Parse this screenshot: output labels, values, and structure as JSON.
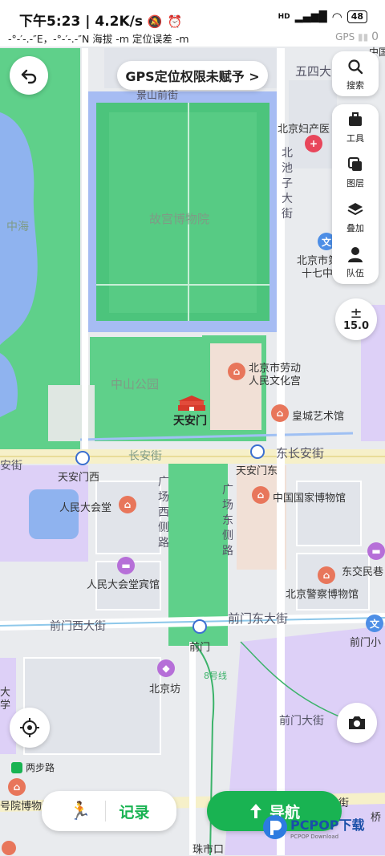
{
  "status": {
    "time": "下午5:23",
    "speed": "4.2K/s",
    "battery": "48",
    "hd": "HD"
  },
  "coords": {
    "text": "-°-′-.-″E，-°-′-.-″N  海拔 -m    定位误差 -m",
    "gps_label": "GPS",
    "gps_signal": "0"
  },
  "gps_banner": {
    "label": "GPS定位权限未赋予 >"
  },
  "toolbar": {
    "search": "搜索",
    "tools": "工具",
    "layers": "图层",
    "overlay": "叠加",
    "team": "队伍",
    "zoom": "15.0"
  },
  "map_labels": {
    "palace": "故宫博物院",
    "zhonghai": "中海",
    "zhongshan": "中山公园",
    "tiananmen": "天安门",
    "changanjie": "长安街",
    "dongchangan": "东长安街",
    "tiananmen_west": "天安门西",
    "tiananmen_east": "天安门东",
    "renmin_dahuitang": "人民大会堂",
    "guoja_bowuguan": "中国国家博物馆",
    "dahuitang_binguan": "人民大会堂宾馆",
    "qianmen_xidajie": "前门西大街",
    "qianmen_dongdajie": "前门东大街",
    "qianmen": "前门",
    "beijingfang": "北京坊",
    "qianmen_dajie": "前门大街",
    "laodong_wenhuagong_1": "北京市劳动",
    "laodong_wenhuagong_2": "人民文化宫",
    "huangcheng": "皇城艺术馆",
    "fuchanyuan": "北京妇产医",
    "shiqizhong_1": "北京市第",
    "shiqizhong_2": "十七中",
    "police_museum": "北京警察博物馆",
    "dongjiaomin": "东交民巷",
    "qianmenxiao": "前门小",
    "wusi": "五四大",
    "jingshan": "景山前街",
    "liangbu": "两步路",
    "line8": "8号线",
    "zhushikou": "珠市口",
    "bowuguan_left": "号院博物馆",
    "daxue_1": "大",
    "daxue_2": "学",
    "an_left": "安街",
    "zhongguo_top": "中国",
    "guangchang_west": "广场西侧路",
    "guangchang_east": "广场东侧路",
    "beichizi": "北池子大街",
    "qiao": "桥",
    "jie": "街"
  },
  "bottom": {
    "record": "记录",
    "navigate": "导航"
  },
  "watermark": {
    "brand": "PCPOP下载",
    "sub": "PCPOP Download"
  },
  "colors": {
    "park_green": "#5fd08a",
    "palace_green": "#4cc47c",
    "moat_blue": "#9fb6f0",
    "nav_green": "#19b352",
    "purple_zone": "#ddd0f7"
  }
}
